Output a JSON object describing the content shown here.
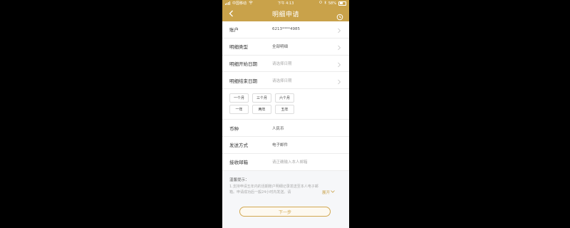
{
  "status_bar": {
    "carrier": "中国移动",
    "time": "下午 4:13",
    "battery": "58%"
  },
  "nav": {
    "title": "明细申请"
  },
  "rows": [
    {
      "label": "账户",
      "value": "6213****4985",
      "placeholder": false
    },
    {
      "label": "明细类型",
      "value": "全部明细",
      "placeholder": false
    },
    {
      "label": "明细开始日期",
      "value": "请选择日期",
      "placeholder": true
    },
    {
      "label": "明细结束日期",
      "value": "请选择日期",
      "placeholder": true
    }
  ],
  "chips": {
    "row1": [
      "一个月",
      "三个月",
      "六个月"
    ],
    "row2": [
      "一年",
      "两年",
      "五年"
    ]
  },
  "fields": [
    {
      "label": "币种",
      "value": "人民币",
      "placeholder": false
    },
    {
      "label": "发送方式",
      "value": "电子邮件",
      "placeholder": false
    },
    {
      "label": "接收邮箱",
      "value": "请正确输入本人邮箱",
      "placeholder": true
    }
  ],
  "tips": {
    "title": "温馨提示：",
    "line1": "1.支持申请五年内的活期账户明细记录发送至本人电子邮",
    "line2": "箱。申请成功后一般24小时内发送。请",
    "expand": "展开"
  },
  "next_button": "下一步",
  "colors": {
    "accent": "#c9a24a"
  }
}
